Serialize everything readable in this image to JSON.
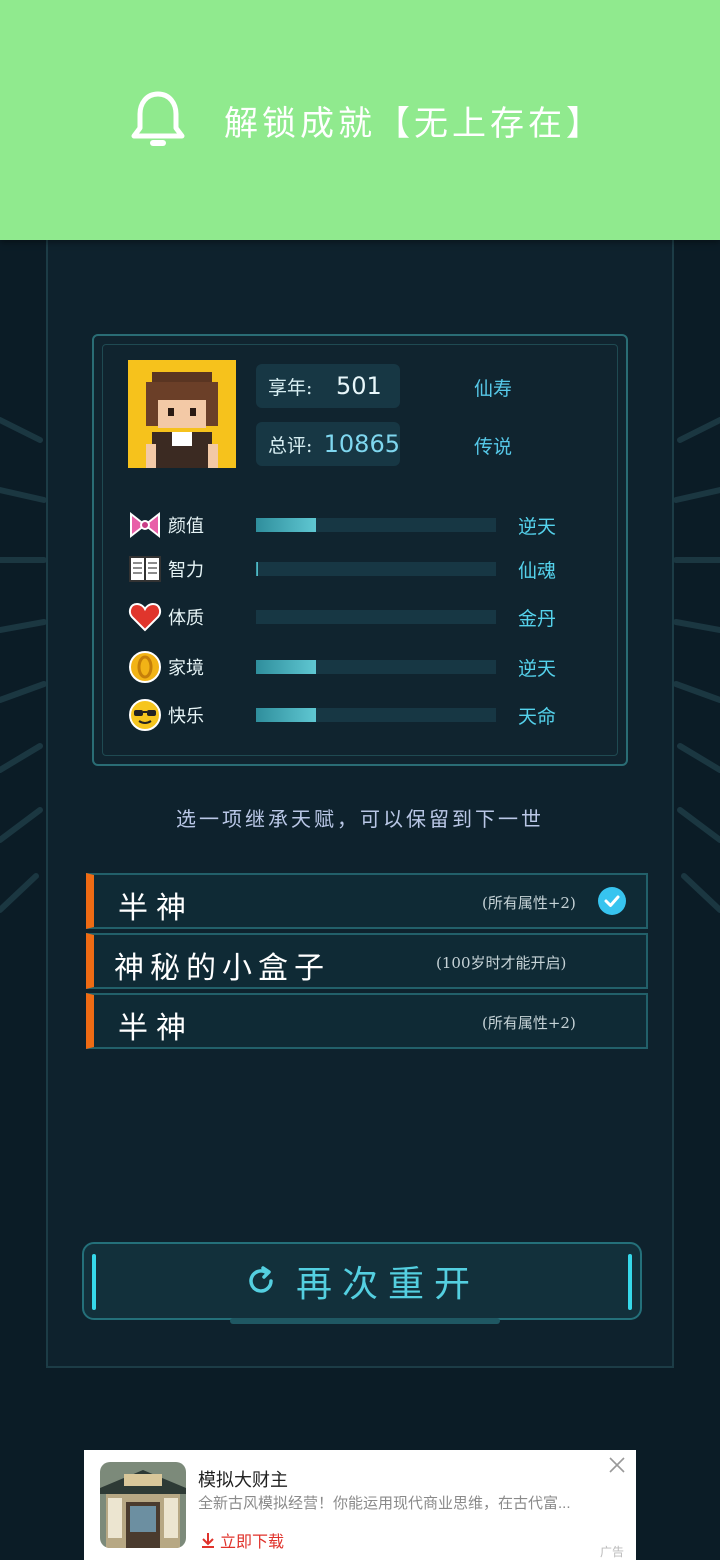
{
  "toast": {
    "icon": "bell-icon",
    "title": "解锁成就【无上存在】"
  },
  "profile": {
    "age_label": "享年:",
    "age_value": "501",
    "age_rank": "仙寿",
    "score_label": "总评:",
    "score_value": "10865",
    "score_rank": "传说"
  },
  "attributes": [
    {
      "icon": "bow-icon",
      "name": "颜值",
      "level": 0.25,
      "grade": "逆天"
    },
    {
      "icon": "book-icon",
      "name": "智力",
      "level": 0.01,
      "grade": "仙魂"
    },
    {
      "icon": "heart-icon",
      "name": "体质",
      "level": 0.0,
      "grade": "金丹"
    },
    {
      "icon": "coin-icon",
      "name": "家境",
      "level": 0.25,
      "grade": "逆天"
    },
    {
      "icon": "sunglasses-face-icon",
      "name": "快乐",
      "level": 0.25,
      "grade": "天命"
    }
  ],
  "hint": "选一项继承天赋，可以保留到下一世",
  "talents": [
    {
      "name": "半神",
      "desc": "(所有属性+2)",
      "selected": true
    },
    {
      "name": "神秘的小盒子",
      "desc": "(100岁时才能开启)",
      "selected": false
    },
    {
      "name": "半神",
      "desc": "(所有属性+2)",
      "selected": false
    }
  ],
  "restart": {
    "icon": "refresh-icon",
    "label": "再次重开"
  },
  "ad": {
    "title": "模拟大财主",
    "desc": "全新古风模拟经营！你能运用现代商业思维，在古代富...",
    "download": "立即下载",
    "tag": "广告"
  },
  "colors": {
    "toast_bg": "#90ea8e",
    "accent_orange": "#ef6b14",
    "accent_cyan": "#36d8ea",
    "bg": "#0b1c26"
  }
}
